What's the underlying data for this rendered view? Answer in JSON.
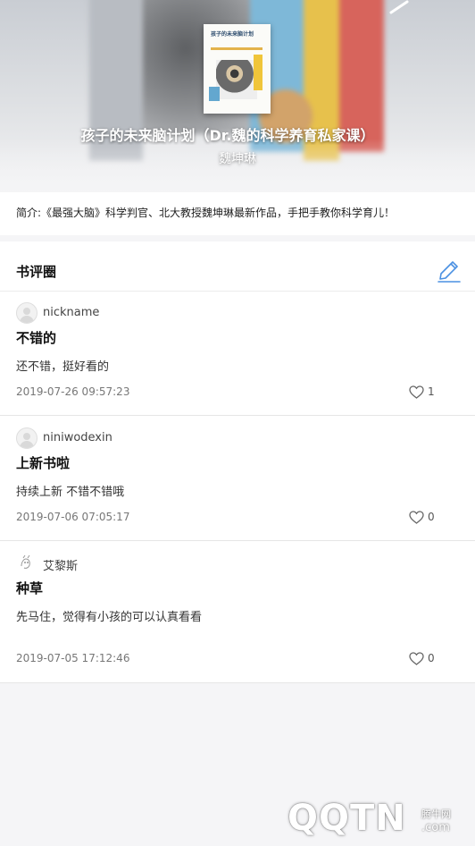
{
  "book": {
    "title": "孩子的未来脑计划（Dr.魏的科学养育私家课）",
    "author": "魏坤琳",
    "cover_text": "孩子的未来脑计划"
  },
  "intro": {
    "text": "简介:《最强大脑》科学判官、北大教授魏坤琳最新作品，手把手教你科学育儿！"
  },
  "reviews_section": {
    "title": "书评圈",
    "edit_icon": "pencil-edit-icon"
  },
  "reviews": [
    {
      "user": "nickname",
      "title": "不错的",
      "body": "还不错，挺好看的",
      "date": "2019-07-26 09:57:23",
      "likes": "1"
    },
    {
      "user": "niniwodexin",
      "title": "上新书啦",
      "body": "持续上新  不错不错哦",
      "date": "2019-07-06 07:05:17",
      "likes": "0"
    },
    {
      "user": "艾黎斯",
      "title": "种草",
      "body": "先马住，觉得有小孩的可以认真看看",
      "date": "2019-07-05 17:12:46",
      "likes": "0"
    }
  ],
  "watermark": {
    "logo": "QQTN",
    "cn": "腾牛网",
    "domain": ".com"
  },
  "colors": {
    "accent": "#4a90e2",
    "background": "#f5f5f7",
    "card": "#ffffff"
  }
}
